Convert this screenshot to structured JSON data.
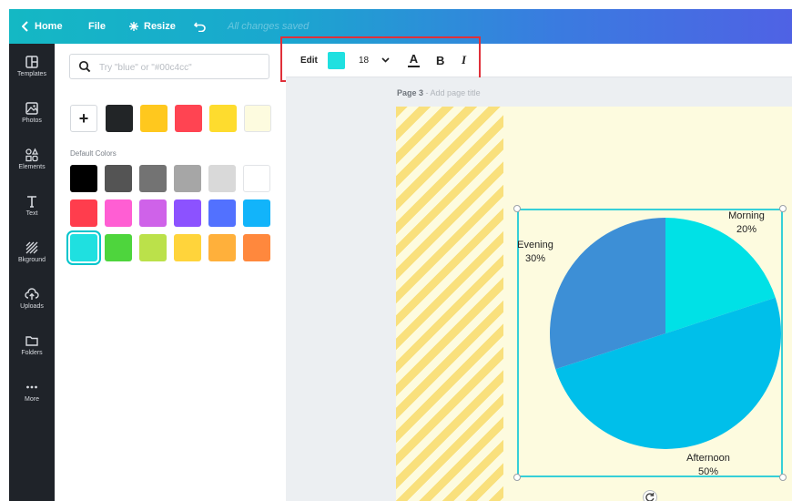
{
  "topbar": {
    "home_label": "Home",
    "file_label": "File",
    "resize_label": "Resize",
    "saved_status": "All changes saved"
  },
  "leftnav": {
    "items": [
      {
        "label": "Templates",
        "icon": "templates-icon"
      },
      {
        "label": "Photos",
        "icon": "photos-icon"
      },
      {
        "label": "Elements",
        "icon": "elements-icon"
      },
      {
        "label": "Text",
        "icon": "text-icon"
      },
      {
        "label": "Bkground",
        "icon": "background-icon"
      },
      {
        "label": "Uploads",
        "icon": "uploads-icon"
      },
      {
        "label": "Folders",
        "icon": "folders-icon"
      },
      {
        "label": "More",
        "icon": "more-icon"
      }
    ]
  },
  "panel": {
    "search_placeholder": "Try \"blue\" or \"#00c4cc\"",
    "document_colors": [
      "#222527",
      "#ffc81e",
      "#ff4452",
      "#fedc2e",
      "#fdfbdf"
    ],
    "default_colors_label": "Default Colors",
    "default_colors": [
      [
        "#000000",
        "#545454",
        "#737373",
        "#a6a6a6",
        "#d9d9d9",
        "#ffffff"
      ],
      [
        "#ff3d4d",
        "#ff5ed3",
        "#cf62e9",
        "#8c52ff",
        "#5271ff",
        "#12b4fa"
      ],
      [
        "#1fe0e0",
        "#4ed53d",
        "#bbe14a",
        "#ffd43b",
        "#ffb03b",
        "#ff883d"
      ]
    ],
    "selected_color": "#1fe0e0"
  },
  "toolbar": {
    "edit_label": "Edit",
    "color_value": "#1fe0e0",
    "font_size": "18",
    "text_color_label": "A",
    "bold_label": "B",
    "italic_label": "I"
  },
  "canvas": {
    "page_label": "Page 3",
    "page_title_placeholder": "- Add page title"
  },
  "chart_data": {
    "type": "pie",
    "categories": [
      "Morning",
      "Afternoon",
      "Evening"
    ],
    "values": [
      20,
      50,
      30
    ],
    "labels": [
      "20%",
      "50%",
      "30%"
    ],
    "colors": [
      "#00e1e6",
      "#00bfea",
      "#3d8fd6"
    ],
    "title": "",
    "legend": "none"
  }
}
